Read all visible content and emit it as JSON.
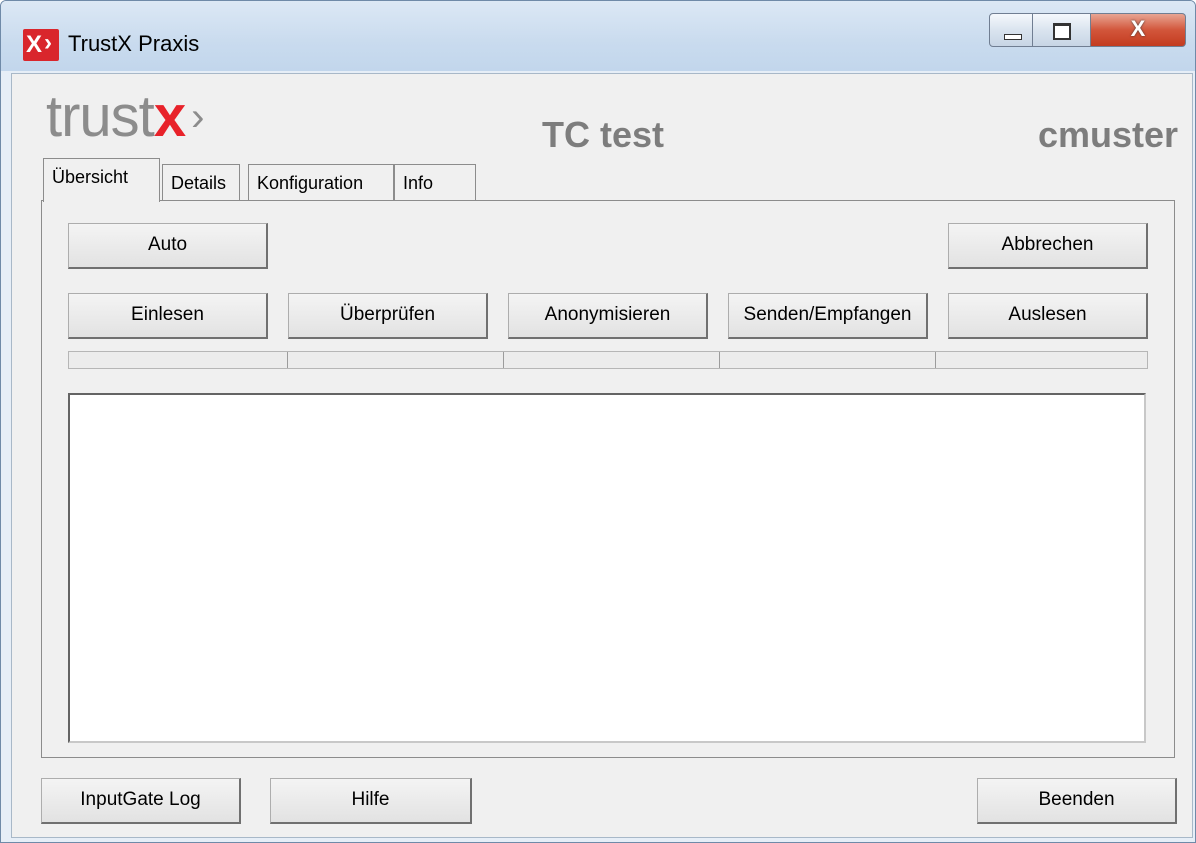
{
  "window": {
    "title": "TrustX Praxis",
    "close_glyph": "X"
  },
  "header": {
    "logo_prefix": "trust",
    "logo_x": "x",
    "logo_arrow": "›",
    "title": "TC test",
    "user": "cmuster"
  },
  "tabs": [
    {
      "label": "Übersicht",
      "active": true
    },
    {
      "label": "Details",
      "active": false
    },
    {
      "label": "Konfiguration",
      "active": false
    },
    {
      "label": "Info",
      "active": false
    }
  ],
  "overview": {
    "auto_label": "Auto",
    "cancel_label": "Abbrechen",
    "actions": [
      "Einlesen",
      "Überprüfen",
      "Anonymisieren",
      "Senden/Empfangen",
      "Auslesen"
    ],
    "progress_fraction": 0,
    "log_text": ""
  },
  "footer": {
    "inputgate_label": "InputGate Log",
    "help_label": "Hilfe",
    "exit_label": "Beenden"
  },
  "colors": {
    "brand_red": "#e8222a",
    "header_gray": "#7d7d7d"
  }
}
